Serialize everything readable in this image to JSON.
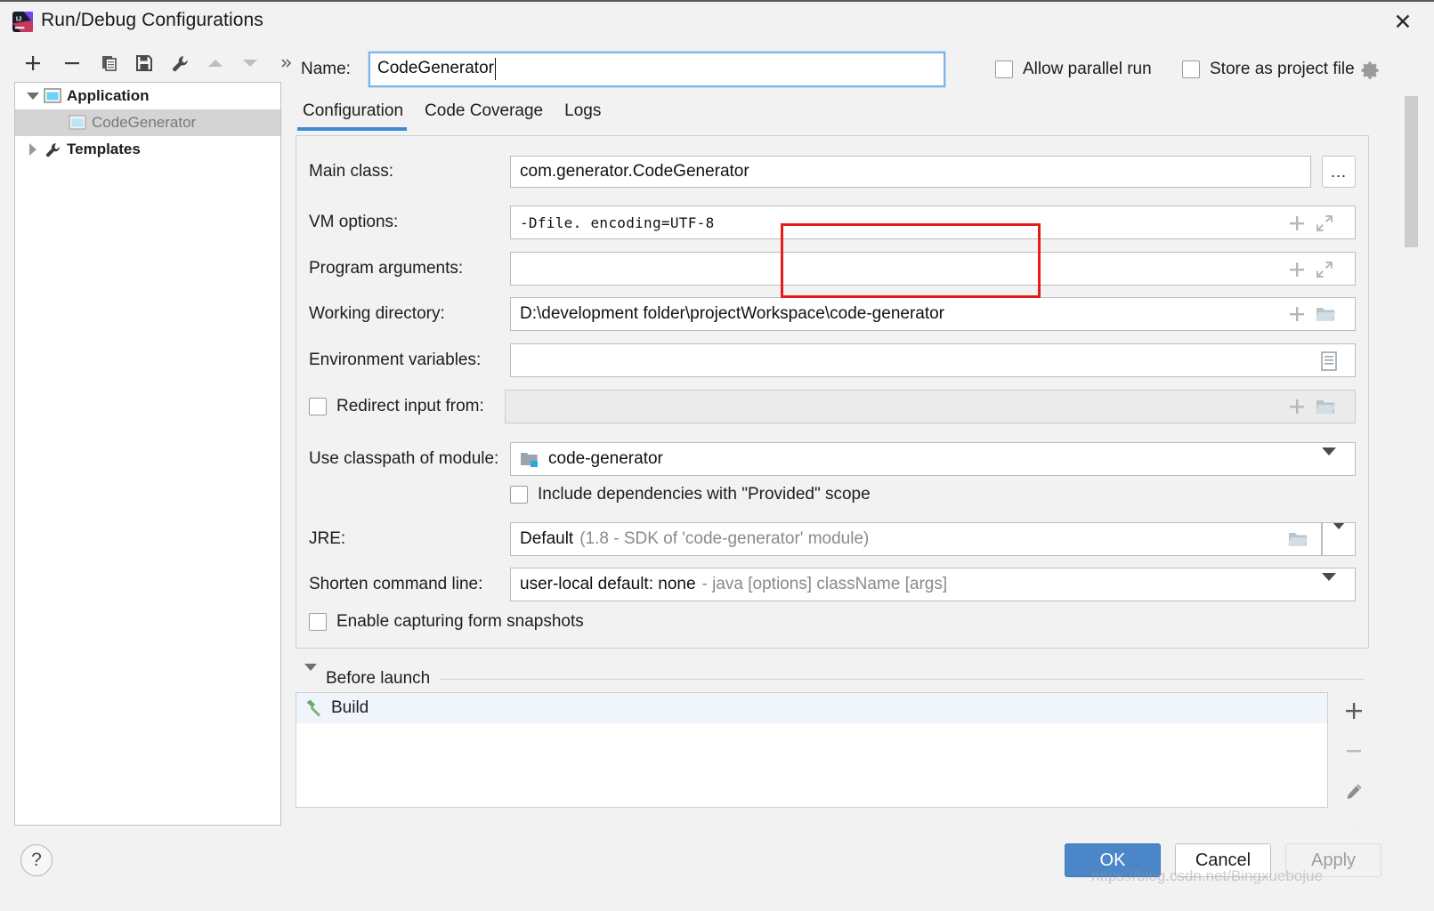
{
  "window": {
    "title": "Run/Debug Configurations",
    "app_icon": "intellij-idea-icon",
    "close_icon": "close-icon"
  },
  "toolbar": {
    "buttons": [
      {
        "name": "add",
        "icon": "plus-icon",
        "label": "+"
      },
      {
        "name": "remove",
        "icon": "minus-icon",
        "label": "−"
      },
      {
        "name": "copy",
        "icon": "copy-icon",
        "label": "copy"
      },
      {
        "name": "save",
        "icon": "save-icon",
        "label": "save"
      },
      {
        "name": "edit-templates",
        "icon": "wrench-icon",
        "label": "wrench"
      },
      {
        "name": "move-up",
        "icon": "arrow-up-icon",
        "label": "up"
      },
      {
        "name": "move-down",
        "icon": "arrow-down-icon",
        "label": "down"
      },
      {
        "name": "more",
        "icon": "chevron-double-right-icon",
        "label": "»"
      }
    ]
  },
  "tree": {
    "items": [
      {
        "label": "Application",
        "icon": "application-icon",
        "arrow": "chevron-down-icon",
        "level": 0,
        "selected": false
      },
      {
        "label": "CodeGenerator",
        "icon": "application-icon",
        "arrow": "",
        "level": 1,
        "selected": true
      },
      {
        "label": "Templates",
        "icon": "wrench-icon",
        "arrow": "chevron-right-icon",
        "level": 0,
        "selected": false
      }
    ]
  },
  "name": {
    "label": "Name:",
    "value": "CodeGenerator",
    "placeholder": ""
  },
  "options": {
    "allow_parallel_run": {
      "label": "Allow parallel run",
      "checked": false
    },
    "store_as_project_file": {
      "label": "Store as project file",
      "checked": false
    },
    "gear_icon": "gear-icon"
  },
  "tabs": [
    {
      "label": "Configuration",
      "active": true
    },
    {
      "label": "Code Coverage",
      "active": false
    },
    {
      "label": "Logs",
      "active": false
    }
  ],
  "fields": {
    "main_class": {
      "label": "Main class:",
      "value": "com.generator.CodeGenerator",
      "browse_label": "...",
      "browse_icon": "ellipsis-icon"
    },
    "vm_options": {
      "label": "VM options:",
      "value": "-Dfile. encoding=UTF-8",
      "add_icon": "plus-icon",
      "expand_icon": "expand-icon",
      "highlighted": true
    },
    "program_arguments": {
      "label": "Program arguments:",
      "value": "",
      "add_icon": "plus-icon",
      "expand_icon": "expand-icon"
    },
    "working_directory": {
      "label": "Working directory:",
      "value": "D:\\development folder\\projectWorkspace\\code-generator",
      "add_icon": "plus-icon",
      "browse_icon": "folder-icon"
    },
    "environment_variables": {
      "label": "Environment variables:",
      "value": "",
      "browse_icon": "list-icon"
    },
    "redirect_input_from": {
      "label": "Redirect input from:",
      "checked": false,
      "value": "",
      "add_icon": "plus-icon",
      "browse_icon": "folder-icon"
    },
    "use_classpath_of_module": {
      "label": "Use classpath of module:",
      "value": "code-generator",
      "module_icon": "module-icon",
      "dropdown_icon": "chevron-down-icon"
    },
    "include_provided_scope": {
      "label": "Include dependencies with \"Provided\" scope",
      "checked": false
    },
    "jre": {
      "label": "JRE:",
      "value": "Default",
      "value_hint": "(1.8 - SDK of 'code-generator' module)",
      "browse_icon": "folder-icon",
      "dropdown_icon": "chevron-down-icon"
    },
    "shorten_command_line": {
      "label": "Shorten command line:",
      "value": "user-local default: none",
      "value_hint": "- java [options] className [args]",
      "dropdown_icon": "chevron-down-icon"
    },
    "enable_form_snapshots": {
      "label": "Enable capturing form snapshots",
      "checked": false
    }
  },
  "before_launch": {
    "title": "Before launch",
    "collapse_icon": "chevron-down-icon",
    "items": [
      {
        "label": "Build",
        "icon": "hammer-icon"
      }
    ],
    "toolbar": [
      {
        "name": "add-task",
        "icon": "plus-icon"
      },
      {
        "name": "remove-task",
        "icon": "minus-icon"
      },
      {
        "name": "edit-task",
        "icon": "pencil-icon"
      },
      {
        "name": "move-task-up",
        "icon": "arrow-up-icon"
      }
    ]
  },
  "footer": {
    "help_label": "?",
    "help_icon": "question-mark-icon",
    "ok_label": "OK",
    "cancel_label": "Cancel",
    "apply_label": "Apply"
  },
  "watermark": {
    "text": "https://blog.csdn.net/Bingxuebojue"
  },
  "colors": {
    "accent": "#4a86c8",
    "tab_underline": "#3f8ad4",
    "highlight_box": "#e81b1b",
    "selection": "#d4d4d4"
  }
}
